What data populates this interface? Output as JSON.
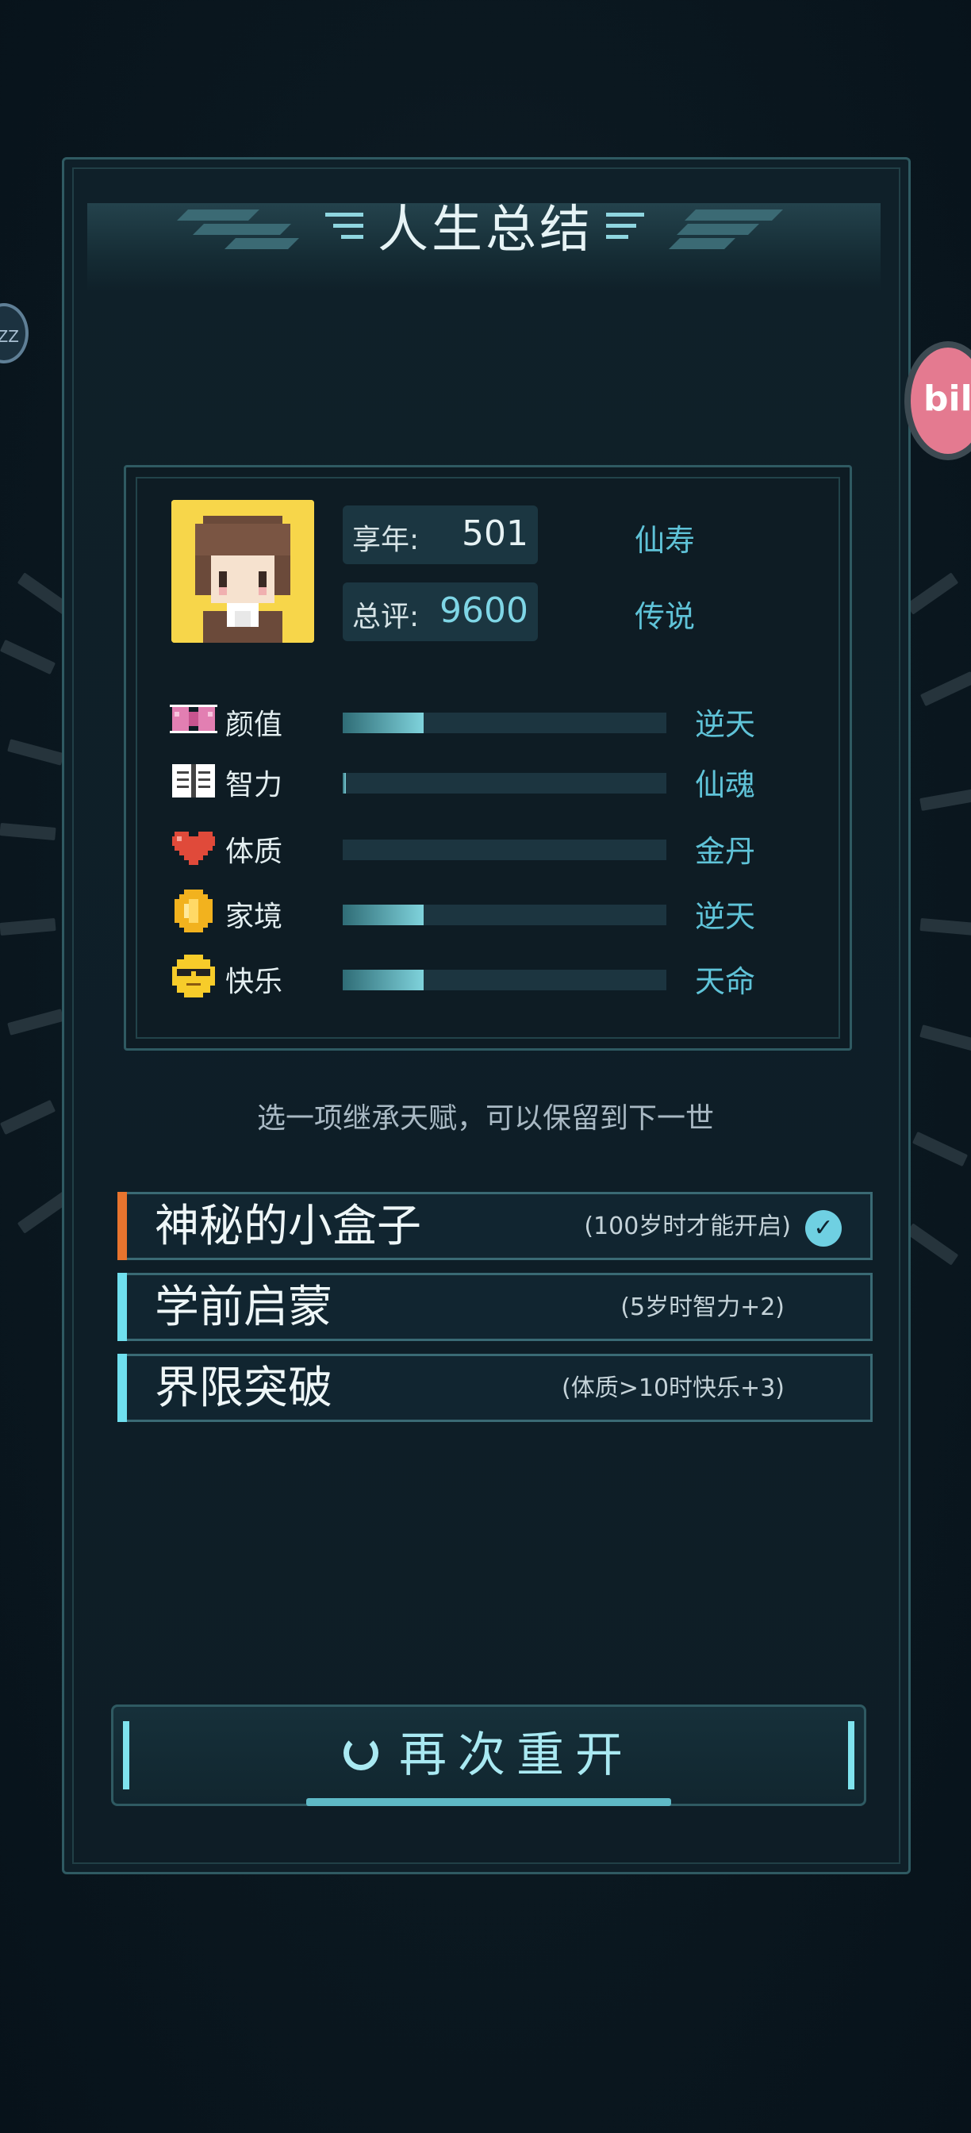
{
  "header": {
    "title": "人生总结"
  },
  "side_buttons": {
    "left_label": "ZZ",
    "right_label": "bili"
  },
  "summary": {
    "age_label": "享年:",
    "age_value": "501",
    "age_rank": "仙寿",
    "score_label": "总评:",
    "score_value": "9600",
    "score_rank": "传说"
  },
  "stats": [
    {
      "name": "颜值",
      "icon": "bow-icon",
      "fill": 0.25,
      "rank": "逆天"
    },
    {
      "name": "智力",
      "icon": "book-icon",
      "fill": 0.01,
      "rank": "仙魂"
    },
    {
      "name": "体质",
      "icon": "heart-icon",
      "fill": 0.0,
      "rank": "金丹"
    },
    {
      "name": "家境",
      "icon": "coin-icon",
      "fill": 0.25,
      "rank": "逆天"
    },
    {
      "name": "快乐",
      "icon": "sunglasses-face-icon",
      "fill": 0.25,
      "rank": "天命"
    }
  ],
  "hint": "选一项继承天赋，可以保留到下一世",
  "talents": [
    {
      "name": "神秘的小盒子",
      "desc": "(100岁时才能开启)",
      "selected": true,
      "accent": "#e8742e"
    },
    {
      "name": "学前启蒙",
      "desc": "(5岁时智力+2)",
      "selected": false,
      "accent": "#6fdfee"
    },
    {
      "name": "界限突破",
      "desc": "(体质>10时快乐+3)",
      "selected": false,
      "accent": "#6fdfee"
    }
  ],
  "restart": {
    "label": "再次重开"
  },
  "colors": {
    "accent_cyan": "#5fc3d8",
    "orange": "#e8742e",
    "panel_border": "#2f5a62"
  }
}
